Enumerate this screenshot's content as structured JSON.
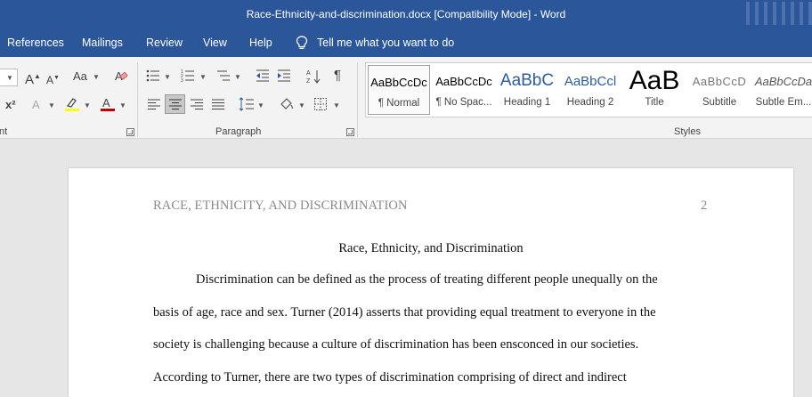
{
  "window": {
    "title": "Race-Ethnicity-and-discrimination.docx [Compatibility Mode]  -  Word"
  },
  "menu": {
    "items": [
      "References",
      "Mailings",
      "Review",
      "View",
      "Help"
    ],
    "tell_me": "Tell me what you want to do"
  },
  "ribbon": {
    "font_group_label_fragment": "nt",
    "paragraph_group_label": "Paragraph",
    "styles_group_label": "Styles",
    "font_buttons": {
      "grow": "A",
      "shrink": "A",
      "case": "Aa",
      "superscript": "x²",
      "text_effects": "A",
      "font_color": "A"
    },
    "styles": [
      {
        "sample": "AaBbCcDc",
        "name": "¶ Normal",
        "selected": true
      },
      {
        "sample": "AaBbCcDc",
        "name": "¶ No Spac...",
        "selected": false
      },
      {
        "sample": "AaBbC",
        "name": "Heading 1",
        "selected": false
      },
      {
        "sample": "AaBbCcl",
        "name": "Heading 2",
        "selected": false
      },
      {
        "sample": "AaB",
        "name": "Title",
        "selected": false
      },
      {
        "sample": "AaBbCcD",
        "name": "Subtitle",
        "selected": false
      },
      {
        "sample": "AaBbCcDa",
        "name": "Subtle Em...",
        "selected": false
      }
    ],
    "colors": {
      "highlight": "#ffff00",
      "font_color": "#c00000"
    }
  },
  "document": {
    "header": "RACE, ETHNICITY, AND DISCRIMINATION",
    "page_number": "2",
    "title": "Race, Ethnicity, and Discrimination",
    "lines": [
      "Discrimination can be defined as the process of treating different people unequally on the",
      "basis of age, race and sex. Turner (2014) asserts that providing equal treatment to everyone in the",
      "society is challenging because a culture of discrimination has been ensconced in our societies.",
      "According to Turner, there are two types of discrimination comprising of direct and indirect"
    ]
  },
  "theme": {
    "titlebar_bg": "#2b579a",
    "ribbon_bg": "#f3f3f3",
    "canvas_bg": "#e6e6e6"
  }
}
